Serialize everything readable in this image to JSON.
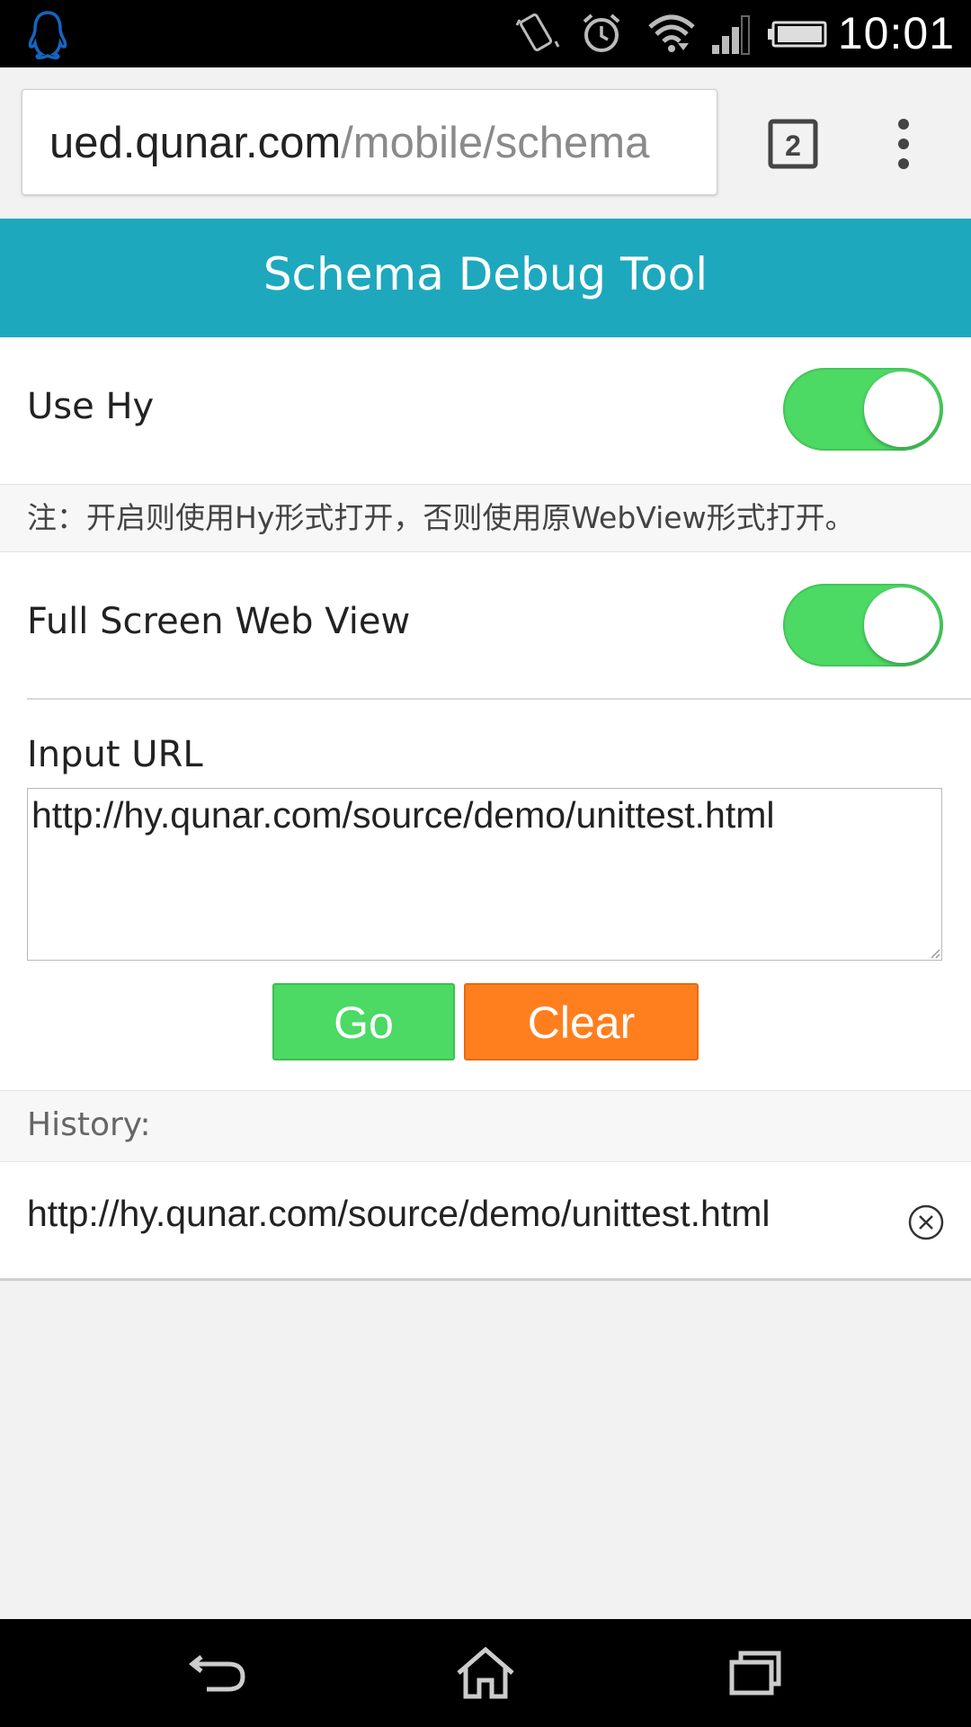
{
  "status_bar": {
    "time": "10:01",
    "icons": [
      "qq-penguin-icon",
      "vibrate-icon",
      "alarm-icon",
      "wifi-icon",
      "signal-icon",
      "battery-icon"
    ]
  },
  "browser": {
    "url_host": "ued.qunar.com",
    "url_path": "/mobile/schema",
    "tab_count": "2"
  },
  "app": {
    "title": "Schema Debug Tool"
  },
  "settings": {
    "use_hy": {
      "label": "Use Hy",
      "enabled": true
    },
    "note": "注：开启则使用Hy形式打开，否则使用原WebView形式打开。",
    "full_screen": {
      "label": "Full Screen Web View",
      "enabled": true
    }
  },
  "input": {
    "label": "Input URL",
    "value": "http://hy.qunar.com/source/demo/unittest.html"
  },
  "buttons": {
    "go": "Go",
    "clear": "Clear"
  },
  "history": {
    "header": "History:",
    "items": [
      {
        "url": "http://hy.qunar.com/source/demo/unittest.html"
      }
    ]
  },
  "colors": {
    "header_bg": "#1ea8bd",
    "toggle_on": "#4cd964",
    "go_button": "#4cd964",
    "clear_button": "#ff7f1f"
  }
}
